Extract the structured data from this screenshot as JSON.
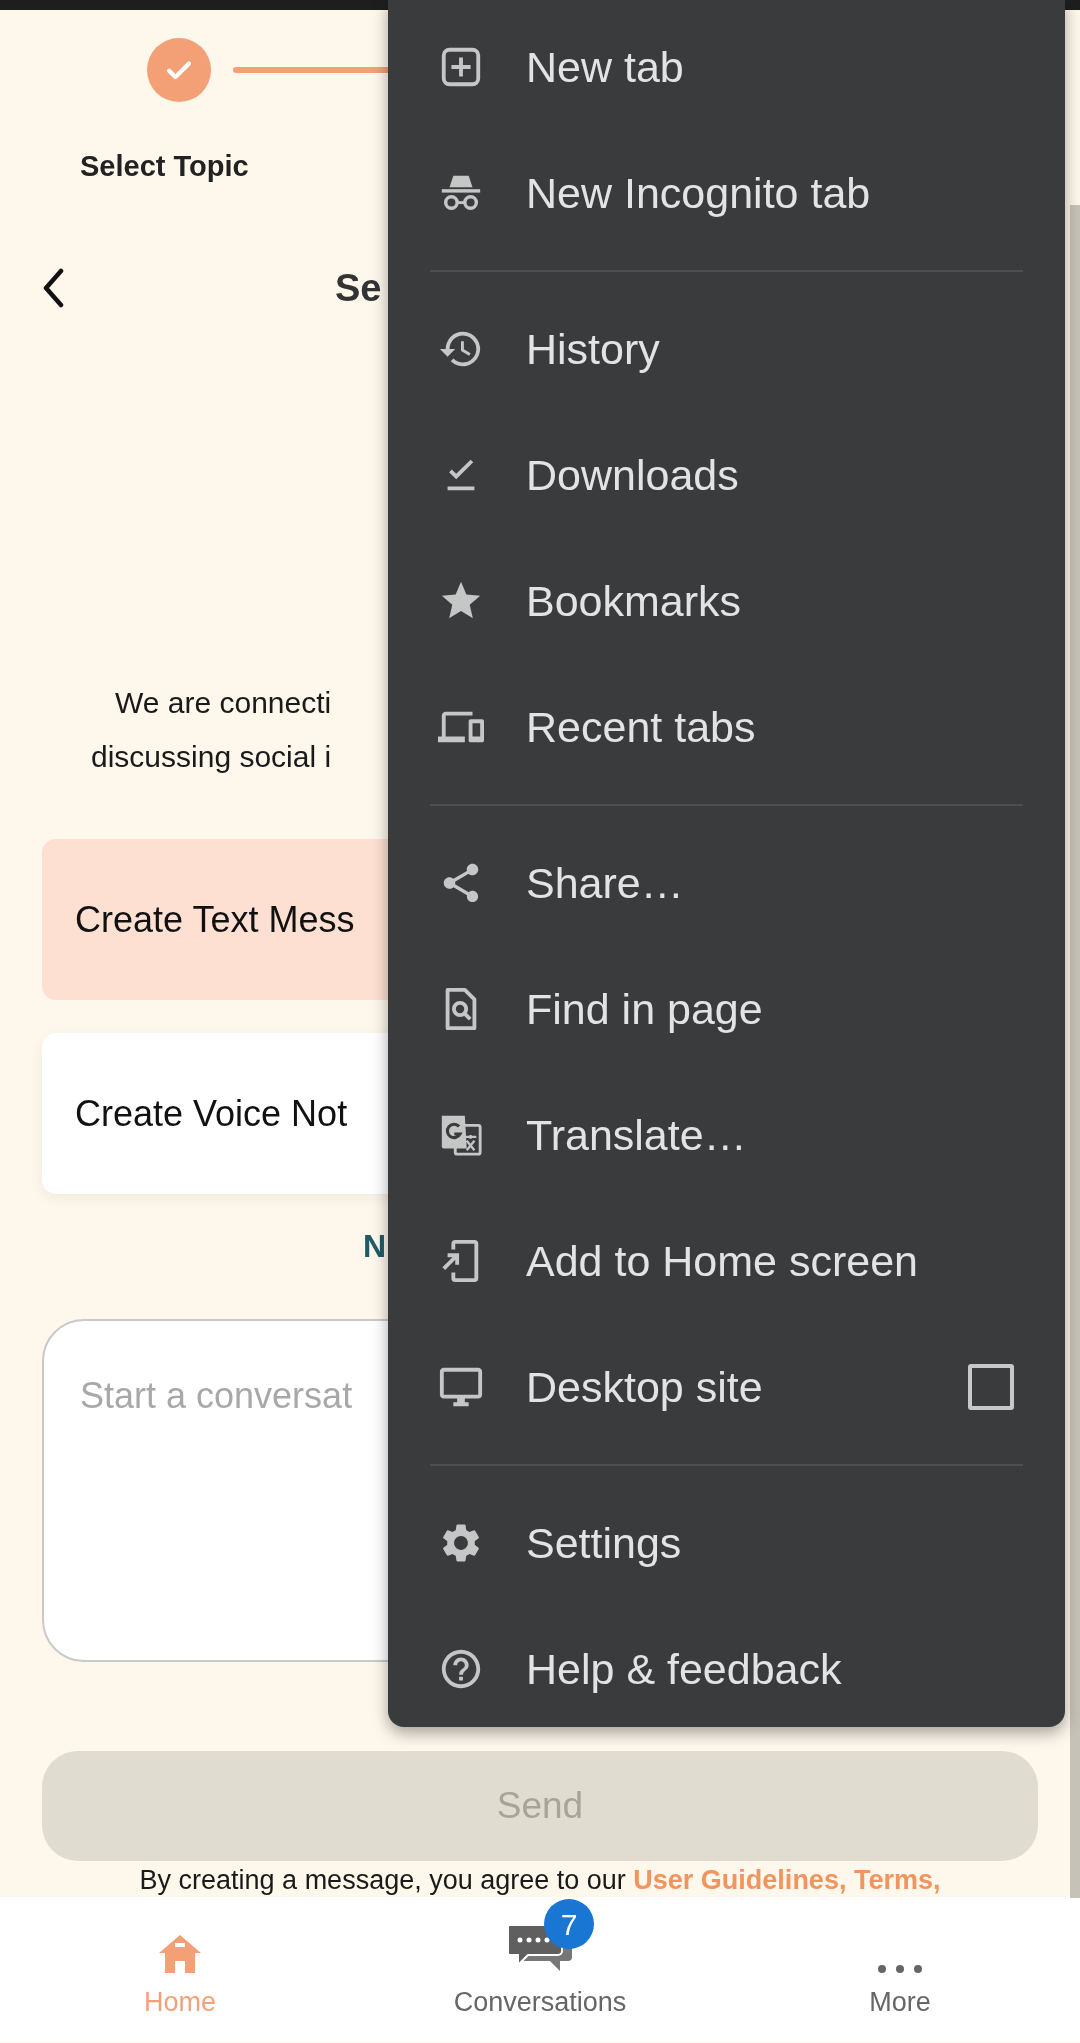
{
  "stepper": {
    "steps": [
      {
        "label": "Select Topic",
        "completed": true
      }
    ]
  },
  "header": {
    "title": "Se"
  },
  "intro": [
    "We are connecti",
    "discussing social i"
  ],
  "options": [
    {
      "label": "Create Text Mess",
      "selected": true
    },
    {
      "label": "Create Voice Not",
      "selected": false
    }
  ],
  "link_partial": "N",
  "message_field": {
    "placeholder": "Start a conversat"
  },
  "send_button": {
    "label": "Send",
    "disabled": true
  },
  "legal": {
    "text": "By creating a message, you agree to our ",
    "link": "User Guidelines, Terms,"
  },
  "bottom_nav": [
    {
      "label": "Home",
      "selected": true
    },
    {
      "label": "Conversations",
      "selected": false,
      "badge": "7"
    },
    {
      "label": "More",
      "selected": false
    }
  ],
  "menu": {
    "groups": [
      [
        {
          "label": "New tab",
          "kind": "item"
        },
        {
          "label": "New Incognito tab",
          "kind": "item"
        }
      ],
      [
        {
          "label": "History",
          "kind": "item"
        },
        {
          "label": "Downloads",
          "kind": "item"
        },
        {
          "label": "Bookmarks",
          "kind": "item"
        },
        {
          "label": "Recent tabs",
          "kind": "item"
        }
      ],
      [
        {
          "label": "Share…",
          "kind": "item"
        },
        {
          "label": "Find in page",
          "kind": "item"
        },
        {
          "label": "Translate…",
          "kind": "item"
        },
        {
          "label": "Add to Home screen",
          "kind": "item"
        },
        {
          "label": "Desktop site",
          "kind": "checkbox",
          "checked": false
        }
      ],
      [
        {
          "label": "Settings",
          "kind": "item"
        },
        {
          "label": "Help & feedback",
          "kind": "item"
        }
      ]
    ]
  }
}
